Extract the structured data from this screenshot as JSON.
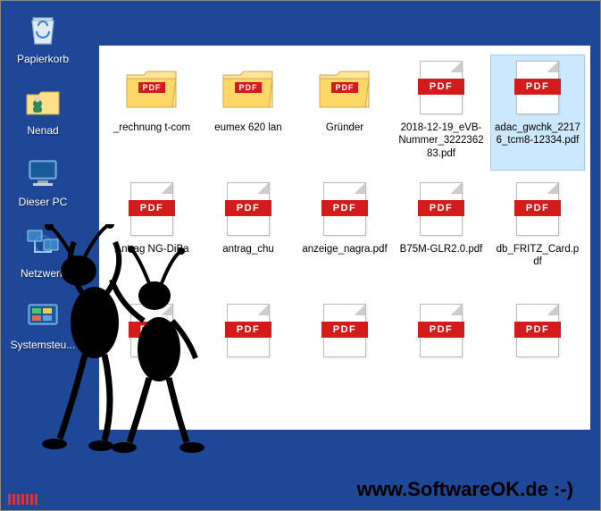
{
  "desktop": {
    "items": [
      {
        "name": "recycle-bin",
        "label": "Papierkorb"
      },
      {
        "name": "user-folder",
        "label": "Nenad"
      },
      {
        "name": "this-pc",
        "label": "Dieser PC"
      },
      {
        "name": "network",
        "label": "Netzwerk"
      },
      {
        "name": "control-panel",
        "label": "Systemsteu..."
      }
    ]
  },
  "folder_band": "PDF",
  "pdf_band": "PDF",
  "files": [
    {
      "type": "folder",
      "label": "_rechnung t-com",
      "selected": false
    },
    {
      "type": "folder",
      "label": "eumex 620 lan",
      "selected": false
    },
    {
      "type": "folder",
      "label": "Gründer",
      "selected": false
    },
    {
      "type": "pdf",
      "label": "2018-12-19_eVB-Nummer_322236283.pdf",
      "selected": false
    },
    {
      "type": "pdf",
      "label": "adac_gwchk_22176_tcm8-12334.pdf",
      "selected": true
    },
    {
      "type": "pdf",
      "label": "Antrag NG-DiBa",
      "selected": false
    },
    {
      "type": "pdf",
      "label": "antrag_chu",
      "selected": false
    },
    {
      "type": "pdf",
      "label": "anzeige_nagra.pdf",
      "selected": false
    },
    {
      "type": "pdf",
      "label": "B75M-GLR2.0.pdf",
      "selected": false
    },
    {
      "type": "pdf",
      "label": "db_FRITZ_Card.pdf",
      "selected": false
    },
    {
      "type": "pdf",
      "label": "",
      "selected": false
    },
    {
      "type": "pdf",
      "label": "",
      "selected": false
    },
    {
      "type": "pdf",
      "label": "",
      "selected": false
    },
    {
      "type": "pdf",
      "label": "",
      "selected": false
    },
    {
      "type": "pdf",
      "label": "",
      "selected": false
    }
  ],
  "watermark": "www.SoftwareOK.de :-)"
}
